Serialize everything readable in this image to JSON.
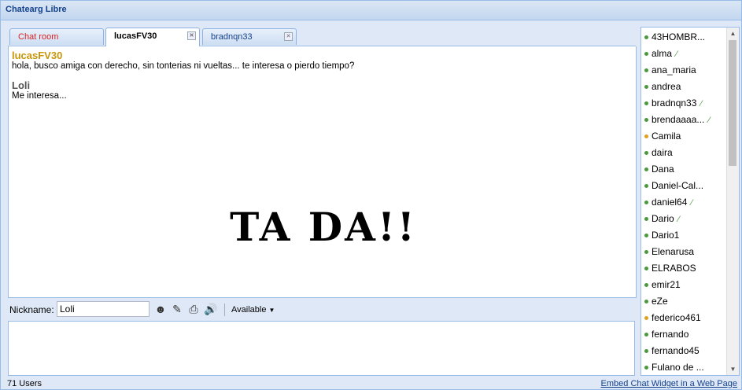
{
  "window": {
    "title": "Chatearg Libre"
  },
  "tabs": [
    {
      "label": "Chat room"
    },
    {
      "label": "lucasFV30"
    },
    {
      "label": "bradnqn33"
    }
  ],
  "messages": [
    {
      "author": "lucasFV30",
      "text": "hola, busco amiga con derecho, sin tonterias ni vueltas... te interesa o pierdo tiempo?"
    },
    {
      "author": "Loli",
      "text": "Me interesa..."
    }
  ],
  "overlay_text": "TA DA!!",
  "toolbar": {
    "nickname_label": "Nickname:",
    "nickname_value": "Loli",
    "status_label": "Available",
    "icons": [
      "smiley-icon",
      "tools-icon",
      "print-icon",
      "sound-icon"
    ]
  },
  "users": [
    {
      "name": "43HOMBR...",
      "status": "online",
      "pen": false
    },
    {
      "name": "alma",
      "status": "online",
      "pen": true
    },
    {
      "name": "ana_maria",
      "status": "online",
      "pen": false
    },
    {
      "name": "andrea",
      "status": "online",
      "pen": false
    },
    {
      "name": "bradnqn33",
      "status": "online",
      "pen": true
    },
    {
      "name": "brendaaaa...",
      "status": "online",
      "pen": true
    },
    {
      "name": "Camila",
      "status": "away",
      "pen": false
    },
    {
      "name": "daira",
      "status": "online",
      "pen": false
    },
    {
      "name": "Dana",
      "status": "online",
      "pen": false
    },
    {
      "name": "Daniel-Cal...",
      "status": "online",
      "pen": false
    },
    {
      "name": "daniel64",
      "status": "online",
      "pen": true
    },
    {
      "name": "Dario",
      "status": "online",
      "pen": true
    },
    {
      "name": "Dario1",
      "status": "online",
      "pen": false
    },
    {
      "name": "Elenarusa",
      "status": "online",
      "pen": false
    },
    {
      "name": "ELRABOS",
      "status": "online",
      "pen": false
    },
    {
      "name": "emir21",
      "status": "online",
      "pen": false
    },
    {
      "name": "eZe",
      "status": "online",
      "pen": false
    },
    {
      "name": "federico461",
      "status": "away",
      "pen": false
    },
    {
      "name": "fernando",
      "status": "online",
      "pen": false
    },
    {
      "name": "fernando45",
      "status": "online",
      "pen": false
    },
    {
      "name": "Fulano de ...",
      "status": "online",
      "pen": false
    }
  ],
  "footer": {
    "user_count": "71 Users",
    "embed_link": "Embed Chat Widget in a Web Page"
  },
  "colors": {
    "chat_room_tab": "#dd2222",
    "author_lucas": "#c8960a",
    "online": "#4a9a3c",
    "away": "#e0a020"
  }
}
